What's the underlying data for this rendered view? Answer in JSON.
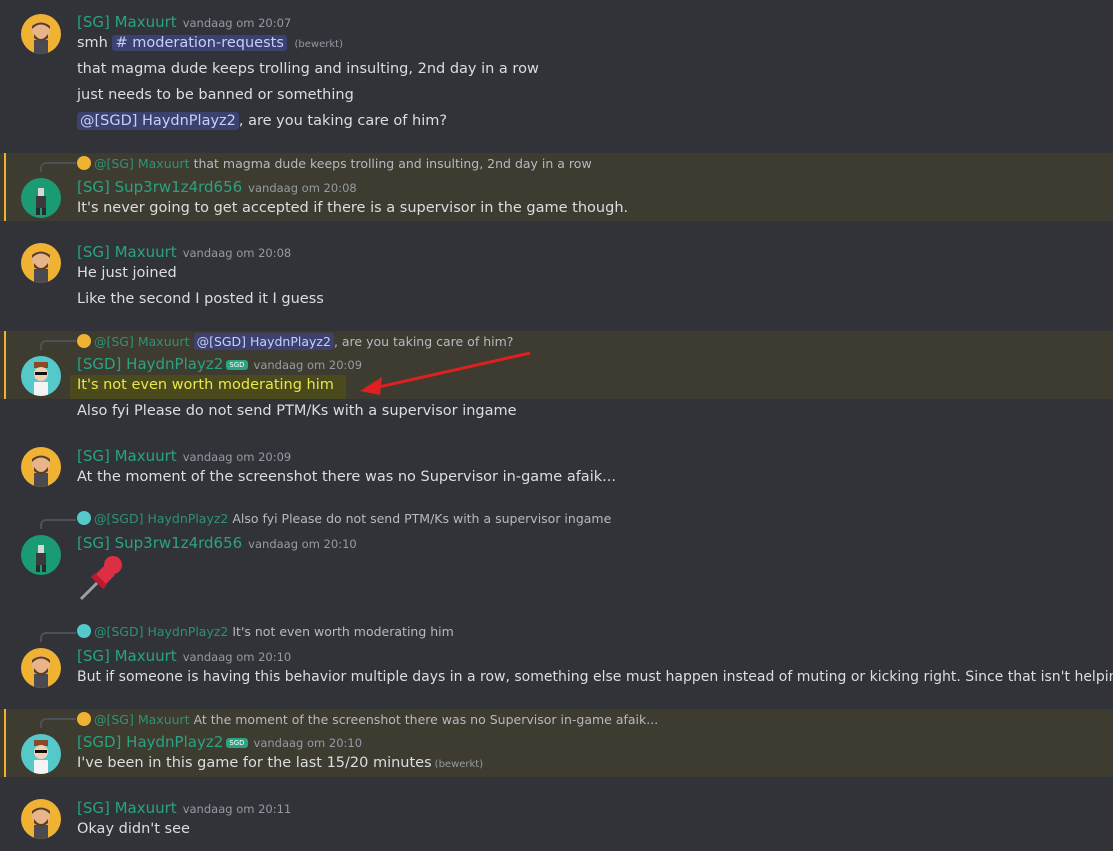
{
  "messages": [
    {
      "author": "[SG] Maxuurt",
      "time": "vandaag om 20:07",
      "line1_prefix": "smh",
      "channel": "# moderation-requests",
      "edited": "(bewerkt)",
      "line2": "that magma dude keeps trolling and insulting, 2nd day in a row",
      "line3": "just needs to be banned or something",
      "mention": "@[SGD] HaydnPlayz2",
      "line4_suffix": ", are you taking care of him?"
    },
    {
      "reply_name": "@[SG] Maxuurt",
      "reply_text": "that magma dude keeps trolling and insulting, 2nd day in a row",
      "author": "[SG] Sup3rw1z4rd656",
      "time": "vandaag om 20:08",
      "line1": "It's never going to get accepted if there is a supervisor in the game though."
    },
    {
      "author": "[SG] Maxuurt",
      "time": "vandaag om 20:08",
      "line1": "He just joined",
      "line2": "Like the second I posted it I guess"
    },
    {
      "reply_name": "@[SG] Maxuurt",
      "reply_mention": "@[SGD] HaydnPlayz2",
      "reply_text": ", are you taking care of him?",
      "author": "[SGD] HaydnPlayz2",
      "badge": "SGD",
      "time": "vandaag om 20:09",
      "line1": "It's not even worth moderating him",
      "line2": "Also fyi Please do not send PTM/Ks with a supervisor ingame"
    },
    {
      "author": "[SG] Maxuurt",
      "time": "vandaag om 20:09",
      "line1": "At the moment of the screenshot there was no Supervisor in-game afaik..."
    },
    {
      "reply_name": "@[SGD] HaydnPlayz2",
      "reply_text": "Also fyi Please do not send PTM/Ks with a supervisor ingame",
      "author": "[SG] Sup3rw1z4rd656",
      "time": "vandaag om 20:10",
      "emoji": "pushpin-icon"
    },
    {
      "reply_name": "@[SGD] HaydnPlayz2",
      "reply_text": "It's not even worth moderating him",
      "author": "[SG] Maxuurt",
      "time": "vandaag om 20:10",
      "line1": "But if someone is having this behavior multiple days in a row, something else must happen instead of muting or kicking right. Since that isn't helping."
    },
    {
      "reply_name": "@[SG] Maxuurt",
      "reply_text": "At the moment of the screenshot there was no Supervisor in-game afaik...",
      "author": "[SGD] HaydnPlayz2",
      "badge": "SGD",
      "time": "vandaag om 20:10",
      "line1": "I've been in this game for the last 15/20 minutes",
      "edited": "(bewerkt)"
    },
    {
      "author": "[SG] Maxuurt",
      "time": "vandaag om 20:11",
      "line1": "Okay didn't see"
    }
  ],
  "colors": {
    "background": "#313338",
    "username": "#2aa381",
    "mention_highlight": "#3e3b31",
    "mention_bar": "#f0b232",
    "annotation_arrow": "#e02020",
    "annotation_highlight": "#4a4a1c"
  }
}
